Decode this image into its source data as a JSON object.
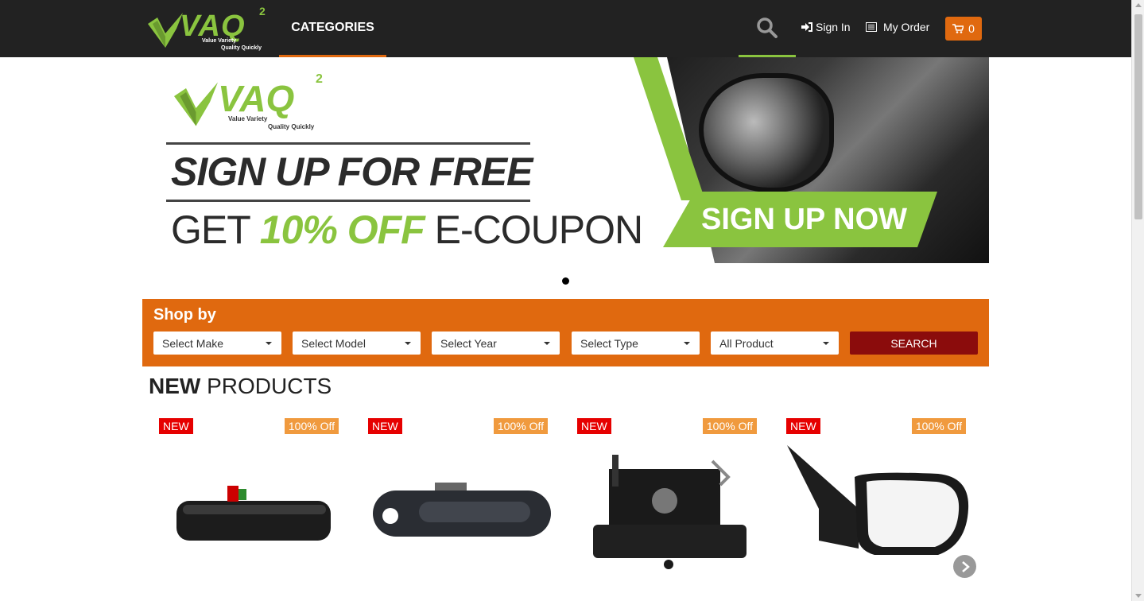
{
  "header": {
    "logo": {
      "brand": "VAQ",
      "sup": "2",
      "tagline_1": "Value Variety",
      "tagline_2": "Quality Quickly"
    },
    "nav": {
      "categories": "CATEGORIES",
      "sign_in": "Sign In",
      "my_order": "My Order",
      "cart_count": "0"
    },
    "colors": {
      "background": "#222222",
      "accent_orange": "#e0690f",
      "accent_green": "#8ac43f"
    }
  },
  "banner": {
    "logo": {
      "brand": "VAQ",
      "sup": "2",
      "tagline_1": "Value Variety",
      "tagline_2": "Quality Quickly"
    },
    "headline": "SIGN UP FOR FREE",
    "sub_prefix": "GET ",
    "sub_highlight": "10% OFF",
    "sub_suffix": " E-COUPON",
    "cta": "SIGN UP NOW"
  },
  "shop_by": {
    "title": "Shop by",
    "selects": [
      {
        "label": "Select Make"
      },
      {
        "label": "Select Model"
      },
      {
        "label": "Select Year"
      },
      {
        "label": "Select Type"
      },
      {
        "label": "All Product"
      }
    ],
    "search_label": "SEARCH"
  },
  "new_products": {
    "title_bold": "NEW",
    "title_rest": " PRODUCTS",
    "items": [
      {
        "badge_new": "NEW",
        "badge_off": "100% Off",
        "icon": "door-handle-icon"
      },
      {
        "badge_new": "NEW",
        "badge_off": "100% Off",
        "icon": "door-handle-icon"
      },
      {
        "badge_new": "NEW",
        "badge_off": "100% Off",
        "icon": "tailgate-latch-icon"
      },
      {
        "badge_new": "NEW",
        "badge_off": "100% Off",
        "icon": "side-mirror-icon"
      }
    ]
  }
}
